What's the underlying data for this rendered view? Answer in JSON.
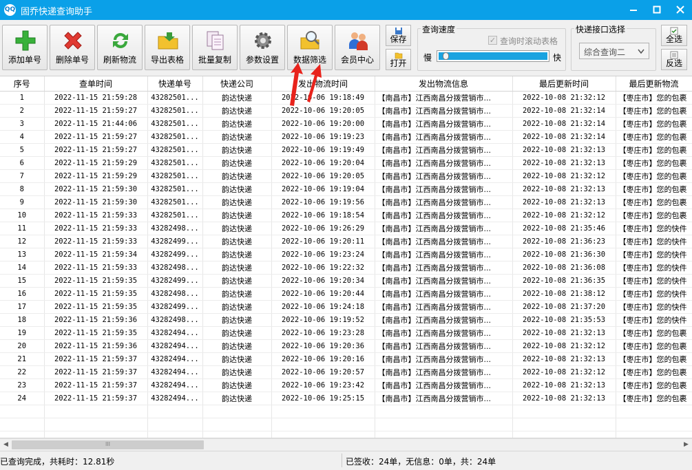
{
  "window": {
    "title": "固乔快递查询助手",
    "icon_text": "QQ"
  },
  "toolbar": {
    "add": "添加单号",
    "delete": "删除单号",
    "refresh": "刷新物流",
    "export": "导出表格",
    "batch_copy": "批量复制",
    "settings": "参数设置",
    "filter": "数据筛选",
    "member": "会员中心",
    "save": "保存",
    "open": "打开"
  },
  "speed": {
    "title": "查询速度",
    "slow": "慢",
    "fast": "快",
    "scroll_label": "查询时滚动表格",
    "scroll_checked": true,
    "level": 0.04
  },
  "api": {
    "title": "快递接口选择",
    "selected": "综合查询二"
  },
  "select": {
    "all": "全选",
    "invert": "反选"
  },
  "table": {
    "headers": [
      "序号",
      "查单时间",
      "快递单号",
      "快递公司",
      "发出物流时间",
      "发出物流信息",
      "最后更新时间",
      "最后更新物流"
    ],
    "rows": [
      [
        "1",
        "2022-11-15 21:59:28",
        "43282501...",
        "韵达快递",
        "2022-10-06 19:18:49",
        "【南昌市】江西南昌分拨营销市...",
        "2022-10-08 21:32:12",
        "【枣庄市】您的包裹"
      ],
      [
        "2",
        "2022-11-15 21:59:27",
        "43282501...",
        "韵达快递",
        "2022-10-06 19:20:05",
        "【南昌市】江西南昌分拨营销市...",
        "2022-10-08 21:32:14",
        "【枣庄市】您的包裹"
      ],
      [
        "3",
        "2022-11-15 21:44:06",
        "43282501...",
        "韵达快递",
        "2022-10-06 19:20:00",
        "【南昌市】江西南昌分拨营销市...",
        "2022-10-08 21:32:14",
        "【枣庄市】您的包裹"
      ],
      [
        "4",
        "2022-11-15 21:59:27",
        "43282501...",
        "韵达快递",
        "2022-10-06 19:19:23",
        "【南昌市】江西南昌分拨营销市...",
        "2022-10-08 21:32:14",
        "【枣庄市】您的包裹"
      ],
      [
        "5",
        "2022-11-15 21:59:27",
        "43282501...",
        "韵达快递",
        "2022-10-06 19:19:49",
        "【南昌市】江西南昌分拨营销市...",
        "2022-10-08 21:32:13",
        "【枣庄市】您的包裹"
      ],
      [
        "6",
        "2022-11-15 21:59:29",
        "43282501...",
        "韵达快递",
        "2022-10-06 19:20:04",
        "【南昌市】江西南昌分拨营销市...",
        "2022-10-08 21:32:13",
        "【枣庄市】您的包裹"
      ],
      [
        "7",
        "2022-11-15 21:59:29",
        "43282501...",
        "韵达快递",
        "2022-10-06 19:20:05",
        "【南昌市】江西南昌分拨营销市...",
        "2022-10-08 21:32:12",
        "【枣庄市】您的包裹"
      ],
      [
        "8",
        "2022-11-15 21:59:30",
        "43282501...",
        "韵达快递",
        "2022-10-06 19:19:04",
        "【南昌市】江西南昌分拨营销市...",
        "2022-10-08 21:32:13",
        "【枣庄市】您的包裹"
      ],
      [
        "9",
        "2022-11-15 21:59:30",
        "43282501...",
        "韵达快递",
        "2022-10-06 19:19:56",
        "【南昌市】江西南昌分拨营销市...",
        "2022-10-08 21:32:13",
        "【枣庄市】您的包裹"
      ],
      [
        "10",
        "2022-11-15 21:59:33",
        "43282501...",
        "韵达快递",
        "2022-10-06 19:18:54",
        "【南昌市】江西南昌分拨营销市...",
        "2022-10-08 21:32:12",
        "【枣庄市】您的包裹"
      ],
      [
        "11",
        "2022-11-15 21:59:33",
        "43282498...",
        "韵达快递",
        "2022-10-06 19:26:29",
        "【南昌市】江西南昌分拨营销市...",
        "2022-10-08 21:35:46",
        "【枣庄市】您的快件"
      ],
      [
        "12",
        "2022-11-15 21:59:33",
        "43282499...",
        "韵达快递",
        "2022-10-06 19:20:11",
        "【南昌市】江西南昌分拨营销市...",
        "2022-10-08 21:36:23",
        "【枣庄市】您的快件"
      ],
      [
        "13",
        "2022-11-15 21:59:34",
        "43282499...",
        "韵达快递",
        "2022-10-06 19:23:24",
        "【南昌市】江西南昌分拨营销市...",
        "2022-10-08 21:36:30",
        "【枣庄市】您的快件"
      ],
      [
        "14",
        "2022-11-15 21:59:33",
        "43282498...",
        "韵达快递",
        "2022-10-06 19:22:32",
        "【南昌市】江西南昌分拨营销市...",
        "2022-10-08 21:36:08",
        "【枣庄市】您的快件"
      ],
      [
        "15",
        "2022-11-15 21:59:35",
        "43282499...",
        "韵达快递",
        "2022-10-06 19:20:34",
        "【南昌市】江西南昌分拨营销市...",
        "2022-10-08 21:36:35",
        "【枣庄市】您的快件"
      ],
      [
        "16",
        "2022-11-15 21:59:35",
        "43282498...",
        "韵达快递",
        "2022-10-06 19:20:44",
        "【南昌市】江西南昌分拨营销市...",
        "2022-10-08 21:38:12",
        "【枣庄市】您的快件"
      ],
      [
        "17",
        "2022-11-15 21:59:35",
        "43282499...",
        "韵达快递",
        "2022-10-06 19:24:18",
        "【南昌市】江西南昌分拨营销市...",
        "2022-10-08 21:37:20",
        "【枣庄市】您的快件"
      ],
      [
        "18",
        "2022-11-15 21:59:36",
        "43282498...",
        "韵达快递",
        "2022-10-06 19:19:52",
        "【南昌市】江西南昌分拨营销市...",
        "2022-10-08 21:35:53",
        "【枣庄市】您的快件"
      ],
      [
        "19",
        "2022-11-15 21:59:35",
        "43282494...",
        "韵达快递",
        "2022-10-06 19:23:28",
        "【南昌市】江西南昌分拨营销市...",
        "2022-10-08 21:32:13",
        "【枣庄市】您的包裹"
      ],
      [
        "20",
        "2022-11-15 21:59:36",
        "43282494...",
        "韵达快递",
        "2022-10-06 19:20:36",
        "【南昌市】江西南昌分拨营销市...",
        "2022-10-08 21:32:12",
        "【枣庄市】您的包裹"
      ],
      [
        "21",
        "2022-11-15 21:59:37",
        "43282494...",
        "韵达快递",
        "2022-10-06 19:20:16",
        "【南昌市】江西南昌分拨营销市...",
        "2022-10-08 21:32:13",
        "【枣庄市】您的包裹"
      ],
      [
        "22",
        "2022-11-15 21:59:37",
        "43282494...",
        "韵达快递",
        "2022-10-06 19:20:57",
        "【南昌市】江西南昌分拨营销市...",
        "2022-10-08 21:32:12",
        "【枣庄市】您的包裹"
      ],
      [
        "23",
        "2022-11-15 21:59:37",
        "43282494...",
        "韵达快递",
        "2022-10-06 19:23:42",
        "【南昌市】江西南昌分拨营销市...",
        "2022-10-08 21:32:13",
        "【枣庄市】您的包裹"
      ],
      [
        "24",
        "2022-11-15 21:59:37",
        "43282494...",
        "韵达快递",
        "2022-10-06 19:25:15",
        "【南昌市】江西南昌分拨营销市...",
        "2022-10-08 21:32:13",
        "【枣庄市】您的包裹"
      ]
    ]
  },
  "status": {
    "left": "已查询完成，共耗时：12.81秒",
    "right": "已签收：24单，无信息：0单，共：24单"
  },
  "colors": {
    "titlebar": "#0aa0e8",
    "annotation_arrow": "#e8231c"
  }
}
